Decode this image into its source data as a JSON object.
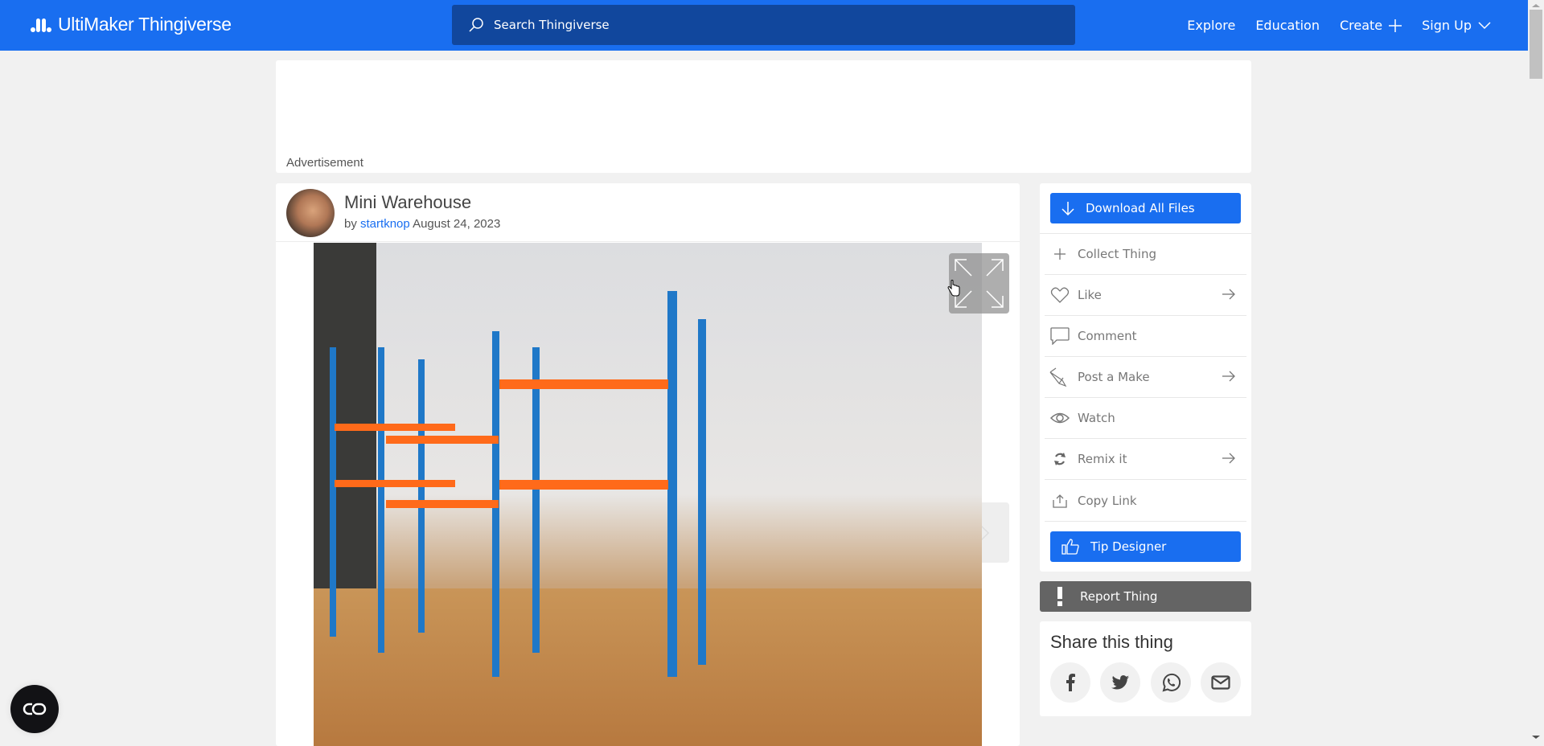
{
  "header": {
    "brand": "UltiMaker Thingiverse",
    "brand_color": "#196ef0",
    "search": {
      "placeholder": "Search Thingiverse",
      "value": ""
    },
    "nav": [
      {
        "label": "Explore",
        "icon": null
      },
      {
        "label": "Education",
        "icon": null
      },
      {
        "label": "Create",
        "icon": "plus-icon"
      },
      {
        "label": "Sign Up",
        "icon": "chevron-down-icon"
      }
    ]
  },
  "ad": {
    "label": "Advertisement"
  },
  "thing": {
    "title": "Mini Warehouse",
    "by_prefix": "by",
    "author": "startknop",
    "date": "August 24, 2023"
  },
  "sidebar": {
    "download_label": "Download All Files",
    "actions": [
      {
        "label": "Collect Thing",
        "icon": "plus-icon",
        "has_arrow": false
      },
      {
        "label": "Like",
        "icon": "heart-icon",
        "has_arrow": true
      },
      {
        "label": "Comment",
        "icon": "comment-icon",
        "has_arrow": false
      },
      {
        "label": "Post a Make",
        "icon": "make-icon",
        "has_arrow": true
      },
      {
        "label": "Watch",
        "icon": "eye-icon",
        "has_arrow": false
      },
      {
        "label": "Remix it",
        "icon": "remix-icon",
        "has_arrow": true
      },
      {
        "label": "Copy Link",
        "icon": "share-icon",
        "has_arrow": false
      }
    ],
    "tip_label": "Tip Designer",
    "report_label": "Report Thing",
    "share": {
      "title": "Share this thing",
      "networks": [
        "facebook",
        "twitter",
        "whatsapp",
        "email"
      ]
    }
  }
}
